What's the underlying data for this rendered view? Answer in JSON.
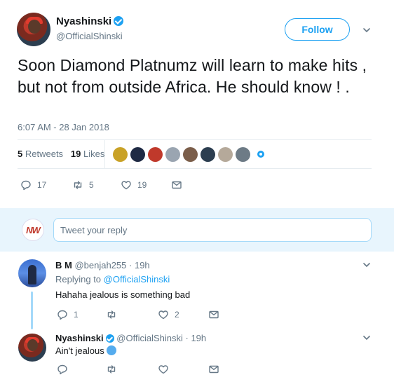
{
  "tweet": {
    "display_name": "Nyashinski",
    "handle": "@OfficialShinski",
    "follow_label": "Follow",
    "text": "Soon Diamond Platnumz will learn to make hits , but not from outside Africa. He should know ! .",
    "timestamp": "6:07 AM - 28 Jan 2018",
    "retweets_count": "5",
    "retweets_label": "Retweets",
    "likes_count": "19",
    "likes_label": "Likes",
    "likers": [
      "#c9a227",
      "#1f2a44",
      "#c0392b",
      "#9aa5b1",
      "#7b5e4a",
      "#2c3e50",
      "#b5a99a",
      "#6d7b86"
    ],
    "actions": {
      "reply_count": "17",
      "retweet_count": "5",
      "like_count": "19"
    }
  },
  "reply_box": {
    "avatar_text": "NW",
    "placeholder": "Tweet your reply"
  },
  "replies": [
    {
      "name": "B M",
      "handle": "@benjah255",
      "time": "19h",
      "replying_prefix": "Replying to",
      "replying_to": "@OfficialShinski",
      "text": "Hahaha jealous is something bad",
      "reply_count": "1",
      "retweet_count": "",
      "like_count": "2"
    },
    {
      "name": "Nyashinski",
      "handle": "@OfficialShinski",
      "time": "19h",
      "text": "Ain't jealous",
      "reply_count": "",
      "retweet_count": "",
      "like_count": ""
    }
  ],
  "colors": {
    "accent": "#1da1f2",
    "muted": "#657786",
    "reply_bar_bg": "#e8f5fd"
  }
}
